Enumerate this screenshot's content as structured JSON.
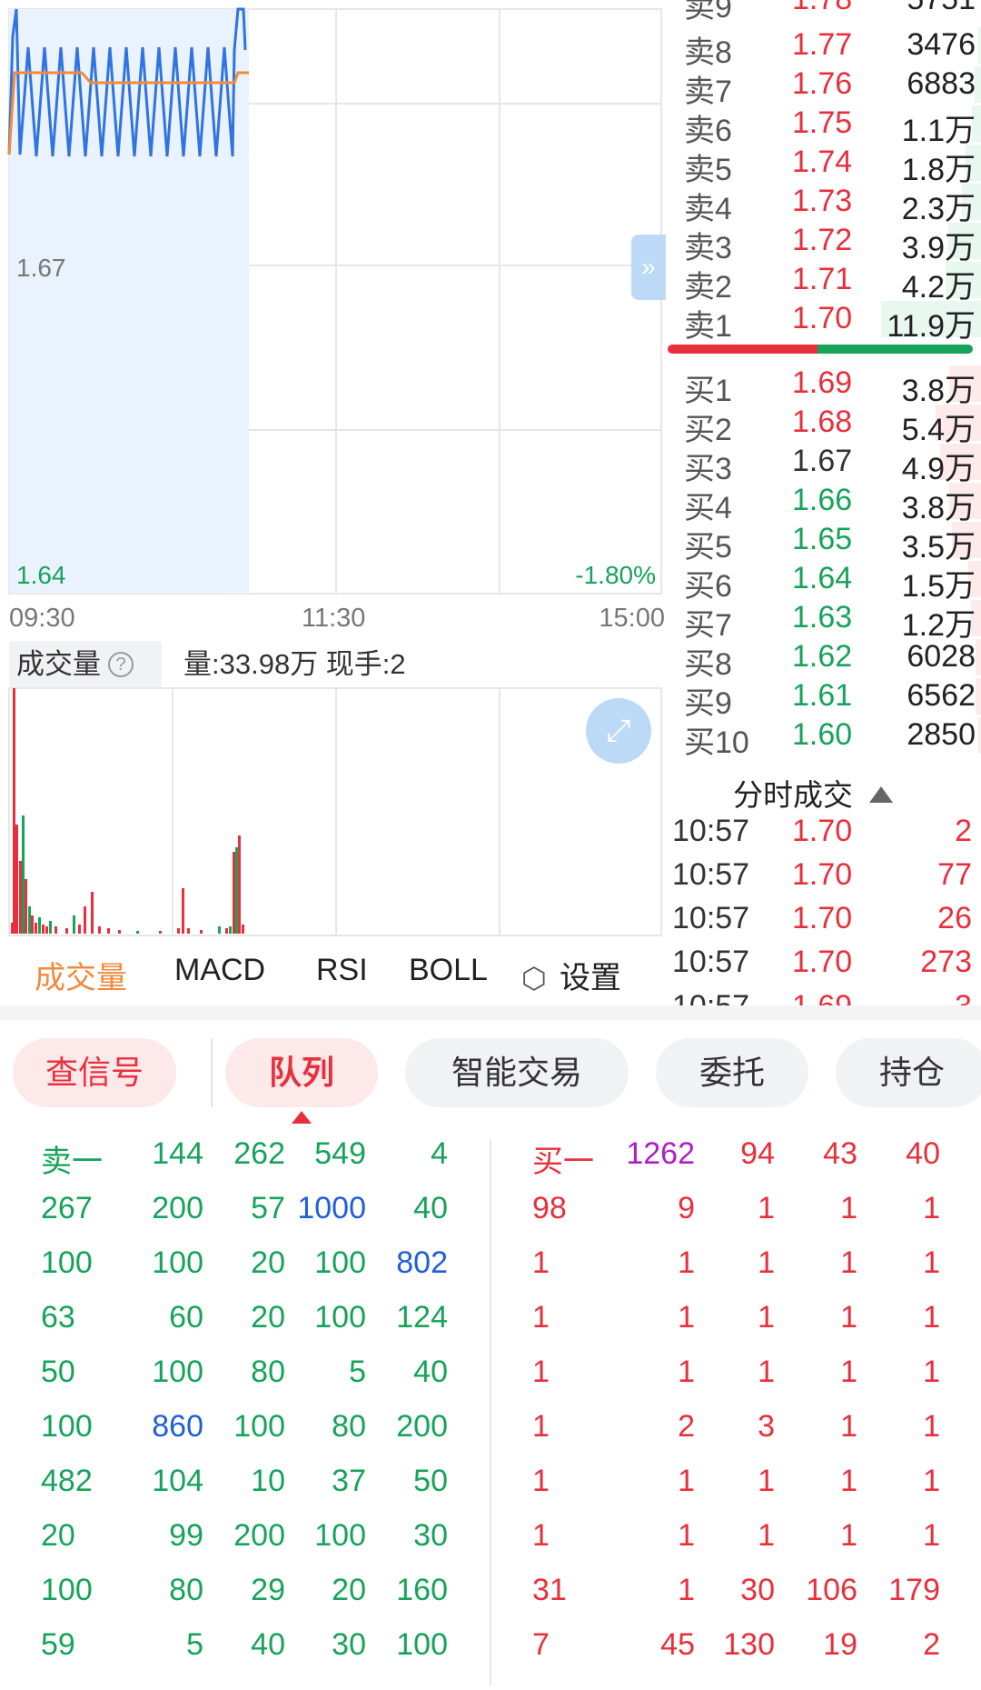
{
  "chart": {
    "price_high_label": "1.67",
    "price_low_label": "1.64",
    "change_label": "-1.80%",
    "times": [
      "09:30",
      "11:30",
      "15:00"
    ],
    "collapse_icon": "chevron-double-right-icon",
    "expand_icon": "expand-icon"
  },
  "volume_header": {
    "title": "成交量",
    "help": "?",
    "info": "量:33.98万 现手:2"
  },
  "indicator_tabs": {
    "items": [
      "成交量",
      "MACD",
      "RSI",
      "BOLL"
    ],
    "settings_label": "设置",
    "active": "成交量",
    "active_color": "#f08a3c"
  },
  "order_book": {
    "sells": [
      {
        "label": "卖8",
        "price": "1.77",
        "vol": "3476",
        "bar": 0.03
      },
      {
        "label": "卖7",
        "price": "1.76",
        "vol": "6883",
        "bar": 0.06
      },
      {
        "label": "卖6",
        "price": "1.75",
        "vol": "1.1万",
        "bar": 0.09
      },
      {
        "label": "卖5",
        "price": "1.74",
        "vol": "1.8万",
        "bar": 0.15
      },
      {
        "label": "卖4",
        "price": "1.73",
        "vol": "2.3万",
        "bar": 0.19
      },
      {
        "label": "卖3",
        "price": "1.72",
        "vol": "3.9万",
        "bar": 0.33
      },
      {
        "label": "卖2",
        "price": "1.71",
        "vol": "4.2万",
        "bar": 0.35
      },
      {
        "label": "卖1",
        "price": "1.70",
        "vol": "11.9万",
        "bar": 1.0
      }
    ],
    "buys": [
      {
        "label": "买1",
        "price": "1.69",
        "vol": "3.8万",
        "pc": "red",
        "bar": 0.32
      },
      {
        "label": "买2",
        "price": "1.68",
        "vol": "5.4万",
        "pc": "red",
        "bar": 0.45
      },
      {
        "label": "买3",
        "price": "1.67",
        "vol": "4.9万",
        "pc": "gray",
        "bar": 0.41
      },
      {
        "label": "买4",
        "price": "1.66",
        "vol": "3.8万",
        "pc": "green",
        "bar": 0.32
      },
      {
        "label": "买5",
        "price": "1.65",
        "vol": "3.5万",
        "pc": "green",
        "bar": 0.29
      },
      {
        "label": "买6",
        "price": "1.64",
        "vol": "1.5万",
        "pc": "green",
        "bar": 0.13
      },
      {
        "label": "买7",
        "price": "1.63",
        "vol": "1.2万",
        "pc": "green",
        "bar": 0.1
      },
      {
        "label": "买8",
        "price": "1.62",
        "vol": "6028",
        "pc": "green",
        "bar": 0.05
      },
      {
        "label": "买9",
        "price": "1.61",
        "vol": "6562",
        "pc": "green",
        "bar": 0.055
      },
      {
        "label": "买10",
        "price": "1.60",
        "vol": "2850",
        "pc": "green",
        "bar": 0.024
      }
    ],
    "sell_ratio": 0.49,
    "trades_title": "分时成交",
    "trades": [
      {
        "time": "10:57",
        "price": "1.70",
        "vol": "2"
      },
      {
        "time": "10:57",
        "price": "1.70",
        "vol": "77"
      },
      {
        "time": "10:57",
        "price": "1.70",
        "vol": "26"
      },
      {
        "time": "10:57",
        "price": "1.70",
        "vol": "273"
      }
    ]
  },
  "function_tabs": {
    "signal": "查信号",
    "queue": "队列",
    "smart": "智能交易",
    "entrust": "委托",
    "position": "持仓",
    "active": "队列"
  },
  "queue": {
    "sell_rows": [
      [
        [
          "卖一",
          "g"
        ],
        [
          "144",
          "g"
        ],
        [
          "262",
          "g"
        ],
        [
          "549",
          "g"
        ],
        [
          "4",
          "g"
        ]
      ],
      [
        [
          "267",
          "g"
        ],
        [
          "200",
          "g"
        ],
        [
          "57",
          "g"
        ],
        [
          "1000",
          "b"
        ],
        [
          "40",
          "g"
        ]
      ],
      [
        [
          "100",
          "g"
        ],
        [
          "100",
          "g"
        ],
        [
          "20",
          "g"
        ],
        [
          "100",
          "g"
        ],
        [
          "802",
          "b"
        ]
      ],
      [
        [
          "63",
          "g"
        ],
        [
          "60",
          "g"
        ],
        [
          "20",
          "g"
        ],
        [
          "100",
          "g"
        ],
        [
          "124",
          "g"
        ]
      ],
      [
        [
          "50",
          "g"
        ],
        [
          "100",
          "g"
        ],
        [
          "80",
          "g"
        ],
        [
          "5",
          "g"
        ],
        [
          "40",
          "g"
        ]
      ],
      [
        [
          "100",
          "g"
        ],
        [
          "860",
          "b"
        ],
        [
          "100",
          "g"
        ],
        [
          "80",
          "g"
        ],
        [
          "200",
          "g"
        ]
      ],
      [
        [
          "482",
          "g"
        ],
        [
          "104",
          "g"
        ],
        [
          "10",
          "g"
        ],
        [
          "37",
          "g"
        ],
        [
          "50",
          "g"
        ]
      ],
      [
        [
          "20",
          "g"
        ],
        [
          "99",
          "g"
        ],
        [
          "200",
          "g"
        ],
        [
          "100",
          "g"
        ],
        [
          "30",
          "g"
        ]
      ],
      [
        [
          "100",
          "g"
        ],
        [
          "80",
          "g"
        ],
        [
          "29",
          "g"
        ],
        [
          "20",
          "g"
        ],
        [
          "160",
          "g"
        ]
      ],
      [
        [
          "59",
          "g"
        ],
        [
          "5",
          "g"
        ],
        [
          "40",
          "g"
        ],
        [
          "30",
          "g"
        ],
        [
          "100",
          "g"
        ]
      ]
    ],
    "buy_rows": [
      [
        [
          "买一",
          "r"
        ],
        [
          "1262",
          "p"
        ],
        [
          "94",
          "r"
        ],
        [
          "43",
          "r"
        ],
        [
          "40",
          "r"
        ]
      ],
      [
        [
          "98",
          "r"
        ],
        [
          "9",
          "r"
        ],
        [
          "1",
          "r"
        ],
        [
          "1",
          "r"
        ],
        [
          "1",
          "r"
        ]
      ],
      [
        [
          "1",
          "r"
        ],
        [
          "1",
          "r"
        ],
        [
          "1",
          "r"
        ],
        [
          "1",
          "r"
        ],
        [
          "1",
          "r"
        ]
      ],
      [
        [
          "1",
          "r"
        ],
        [
          "1",
          "r"
        ],
        [
          "1",
          "r"
        ],
        [
          "1",
          "r"
        ],
        [
          "1",
          "r"
        ]
      ],
      [
        [
          "1",
          "r"
        ],
        [
          "1",
          "r"
        ],
        [
          "1",
          "r"
        ],
        [
          "1",
          "r"
        ],
        [
          "1",
          "r"
        ]
      ],
      [
        [
          "1",
          "r"
        ],
        [
          "2",
          "r"
        ],
        [
          "3",
          "r"
        ],
        [
          "1",
          "r"
        ],
        [
          "1",
          "r"
        ]
      ],
      [
        [
          "1",
          "r"
        ],
        [
          "1",
          "r"
        ],
        [
          "1",
          "r"
        ],
        [
          "1",
          "r"
        ],
        [
          "1",
          "r"
        ]
      ],
      [
        [
          "1",
          "r"
        ],
        [
          "1",
          "r"
        ],
        [
          "1",
          "r"
        ],
        [
          "1",
          "r"
        ],
        [
          "1",
          "r"
        ]
      ],
      [
        [
          "31",
          "r"
        ],
        [
          "1",
          "r"
        ],
        [
          "30",
          "r"
        ],
        [
          "106",
          "r"
        ],
        [
          "179",
          "r"
        ]
      ],
      [
        [
          "7",
          "r"
        ],
        [
          "45",
          "r"
        ],
        [
          "130",
          "r"
        ],
        [
          "19",
          "r"
        ],
        [
          "2",
          "r"
        ]
      ]
    ]
  },
  "colors": {
    "red": "#e8303d",
    "green": "#16a35a",
    "blue": "#1f5fd6",
    "purple": "#b01ec9",
    "price_line": "#2f74e0",
    "avg_line": "#f08a3c"
  }
}
